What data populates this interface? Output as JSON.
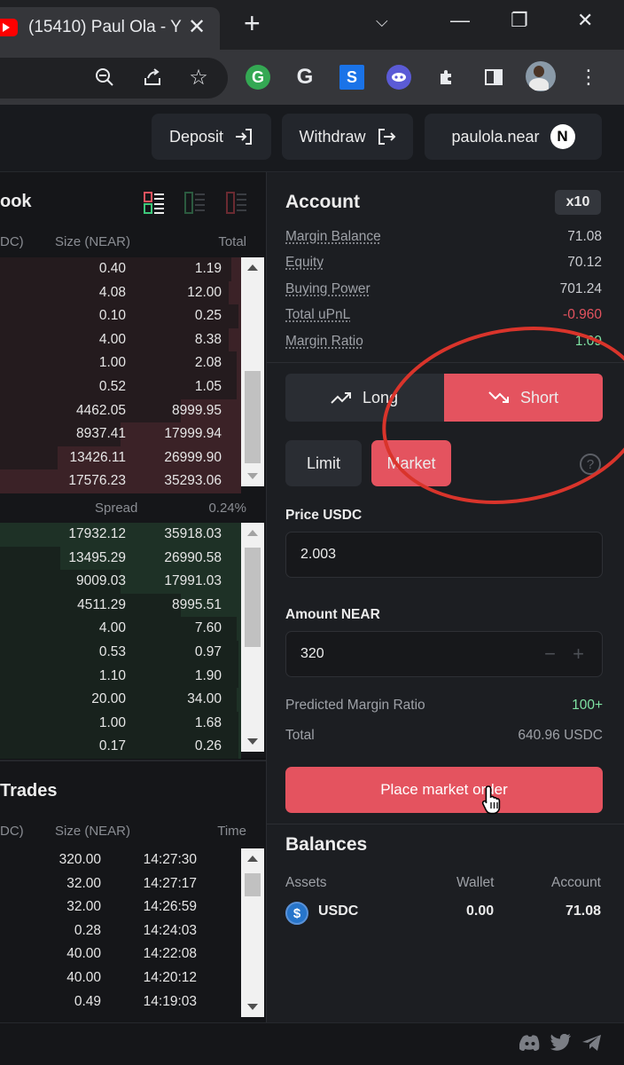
{
  "browser": {
    "tab_title": "(15410) Paul Ola - Y",
    "new_tab_symbol": "+"
  },
  "header": {
    "deposit_label": "Deposit",
    "withdraw_label": "Withdraw",
    "account_name": "paulola.near"
  },
  "orderbook": {
    "title": "ook",
    "col_price": "DC)",
    "col_size": "Size (NEAR)",
    "col_total": "Total",
    "asks": [
      {
        "size": "0.40",
        "total": "1.19",
        "depth": 0.04
      },
      {
        "size": "4.08",
        "total": "12.00",
        "depth": 0.05
      },
      {
        "size": "0.10",
        "total": "0.25",
        "depth": 0.01
      },
      {
        "size": "4.00",
        "total": "8.38",
        "depth": 0.05
      },
      {
        "size": "1.00",
        "total": "2.08",
        "depth": 0.02
      },
      {
        "size": "0.52",
        "total": "1.05",
        "depth": 0.02
      },
      {
        "size": "4462.05",
        "total": "8999.95",
        "depth": 0.25
      },
      {
        "size": "8937.41",
        "total": "17999.94",
        "depth": 0.5
      },
      {
        "size": "13426.11",
        "total": "26999.90",
        "depth": 0.76
      },
      {
        "size": "17576.23",
        "total": "35293.06",
        "depth": 1.0
      }
    ],
    "spread_label": "Spread",
    "spread_value": "0.24%",
    "bids": [
      {
        "size": "17932.12",
        "total": "35918.03",
        "depth": 1.0
      },
      {
        "size": "13495.29",
        "total": "26990.58",
        "depth": 0.75
      },
      {
        "size": "9009.03",
        "total": "17991.03",
        "depth": 0.5
      },
      {
        "size": "4511.29",
        "total": "8995.51",
        "depth": 0.25
      },
      {
        "size": "4.00",
        "total": "7.60",
        "depth": 0.02
      },
      {
        "size": "0.53",
        "total": "0.97",
        "depth": 0.01
      },
      {
        "size": "1.10",
        "total": "1.90",
        "depth": 0.01
      },
      {
        "size": "20.00",
        "total": "34.00",
        "depth": 0.02
      },
      {
        "size": "1.00",
        "total": "1.68",
        "depth": 0.01
      },
      {
        "size": "0.17",
        "total": "0.26",
        "depth": 0.01
      }
    ]
  },
  "trades": {
    "title": "Trades",
    "col_price": "DC)",
    "col_size": "Size (NEAR)",
    "col_time": "Time",
    "rows": [
      {
        "size": "320.00",
        "time": "14:27:30"
      },
      {
        "size": "32.00",
        "time": "14:27:17"
      },
      {
        "size": "32.00",
        "time": "14:26:59"
      },
      {
        "size": "0.28",
        "time": "14:24:03"
      },
      {
        "size": "40.00",
        "time": "14:22:08"
      },
      {
        "size": "40.00",
        "time": "14:20:12"
      },
      {
        "size": "0.49",
        "time": "14:19:03"
      }
    ]
  },
  "account": {
    "title": "Account",
    "leverage": "x10",
    "margin_balance_label": "Margin Balance",
    "margin_balance": "71.08",
    "equity_label": "Equity",
    "equity": "70.12",
    "buying_power_label": "Buying Power",
    "buying_power": "701.24",
    "upnl_label": "Total uPnL",
    "upnl": "-0.960",
    "margin_ratio_label": "Margin Ratio",
    "margin_ratio": "1.09"
  },
  "order": {
    "long_label": "Long",
    "short_label": "Short",
    "limit_label": "Limit",
    "market_label": "Market",
    "price_label": "Price USDC",
    "price_value": "2.003",
    "amount_label": "Amount NEAR",
    "amount_value": "320",
    "predicted_label": "Predicted Margin Ratio",
    "predicted_value": "100+",
    "total_label": "Total",
    "total_value": "640.96 USDC",
    "place_label": "Place market order"
  },
  "balances": {
    "title": "Balances",
    "col_assets": "Assets",
    "col_wallet": "Wallet",
    "col_account": "Account",
    "asset": "USDC",
    "wallet": "0.00",
    "account": "71.08"
  },
  "colors": {
    "short": "#e4535f",
    "positive": "#7fe3a3",
    "negative": "#e4535f",
    "annotation": "#d9342b"
  }
}
